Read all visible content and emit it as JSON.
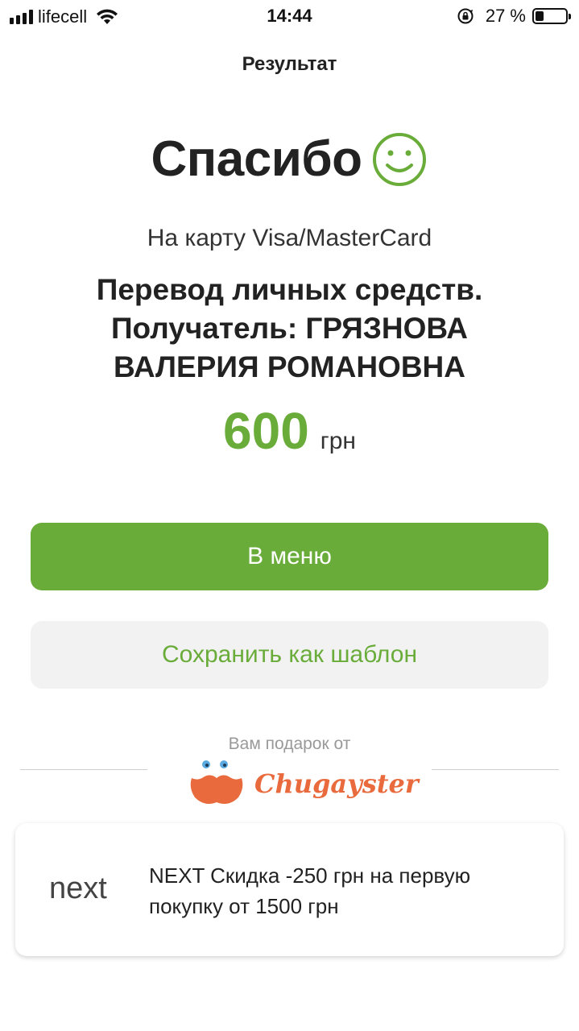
{
  "status_bar": {
    "carrier": "lifecell",
    "time": "14:44",
    "battery_percent": "27 %",
    "battery_level": 0.27,
    "icons": [
      "signal-icon",
      "wifi-icon",
      "rotation-lock-icon",
      "battery-icon"
    ]
  },
  "nav": {
    "title": "Результат"
  },
  "result": {
    "thanks": "Спасибо",
    "subtitle": "На карту Visa/MasterCard",
    "purpose": "Перевод личных средств. Получатель: ГРЯЗНОВА ВАЛЕРИЯ РОМАНОВНА",
    "amount": "600",
    "currency": "грн"
  },
  "buttons": {
    "menu_label": "В меню",
    "save_label": "Сохранить как шаблон"
  },
  "gift": {
    "label": "Вам подарок от",
    "partner": "Chugayster"
  },
  "offer": {
    "brand": "next",
    "text": "NEXT  Скидка -250 грн на первую покупку от 1500 грн"
  },
  "colors": {
    "accent_green": "#6aac3a",
    "partner_orange": "#e96a3c",
    "secondary_button_bg": "#f2f2f2"
  }
}
